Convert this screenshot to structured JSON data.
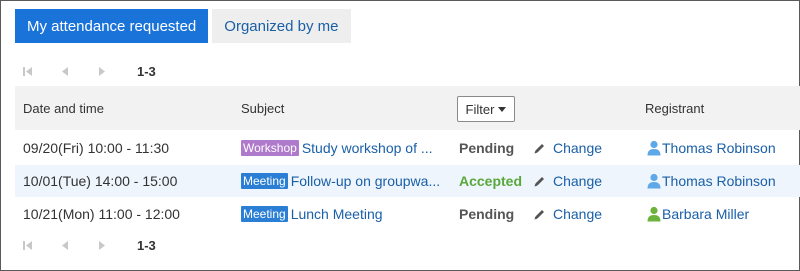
{
  "tabs": [
    {
      "label": "My attendance requested",
      "active": true
    },
    {
      "label": "Organized by me",
      "active": false
    }
  ],
  "pager": {
    "range": "1-3",
    "icons": [
      "first-page-icon",
      "previous-page-icon",
      "next-page-icon"
    ]
  },
  "table": {
    "headers": {
      "date": "Date and time",
      "subject": "Subject",
      "filter": "Filter",
      "registrant": "Registrant"
    },
    "rows": [
      {
        "datetime": "09/20(Fri) 10:00 - 11:30",
        "badge": "Workshop",
        "subject": "Study workshop of ...",
        "status": "Pending",
        "action": "Change",
        "registrant": "Thomas Robinson"
      },
      {
        "datetime": "10/01(Tue) 14:00 - 15:00",
        "badge": "Meeting",
        "subject": "Follow-up on groupwa...",
        "status": "Accepted",
        "action": "Change",
        "registrant": "Thomas Robinson"
      },
      {
        "datetime": "10/21(Mon) 11:00 - 12:00",
        "badge": "Meeting",
        "subject": "Lunch Meeting",
        "status": "Pending",
        "action": "Change",
        "registrant": "Barbara Miller"
      }
    ]
  },
  "colors": {
    "accent": "#1a73d9",
    "link": "#1a5fa8",
    "workshop_badge": "#b07acc",
    "meeting_badge": "#2a7fd4",
    "accepted": "#5aa83c",
    "user_icon_blue": "#5fa8e8",
    "user_icon_green": "#6cb33e"
  }
}
